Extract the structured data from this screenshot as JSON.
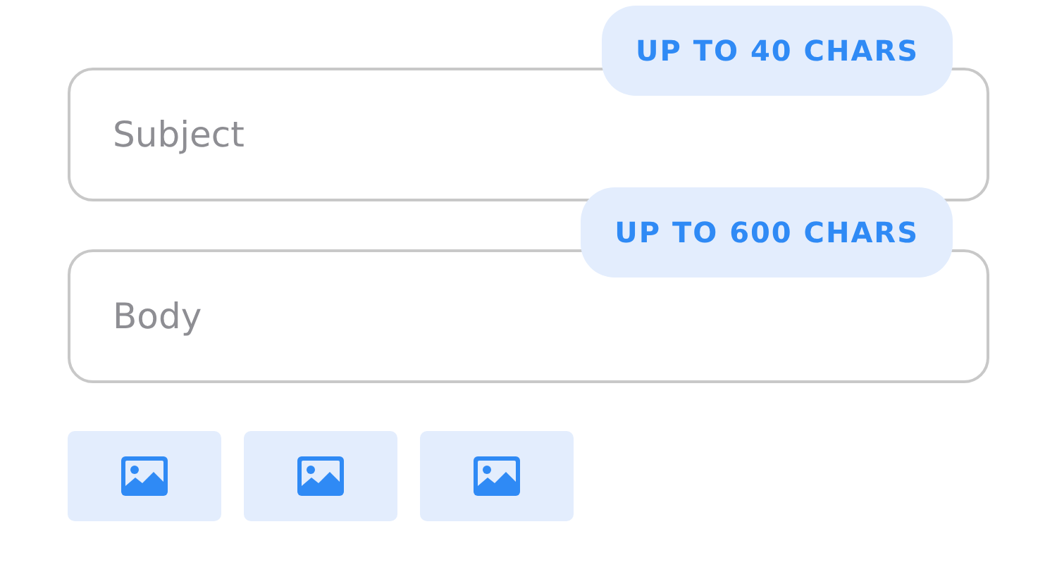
{
  "fields": [
    {
      "placeholder": "Subject",
      "limit_badge": "UP TO 40 CHARS"
    },
    {
      "placeholder": "Body",
      "limit_badge": "UP TO 600 CHARS"
    }
  ],
  "attachments": [
    {
      "kind": "image"
    },
    {
      "kind": "image"
    },
    {
      "kind": "image"
    }
  ]
}
